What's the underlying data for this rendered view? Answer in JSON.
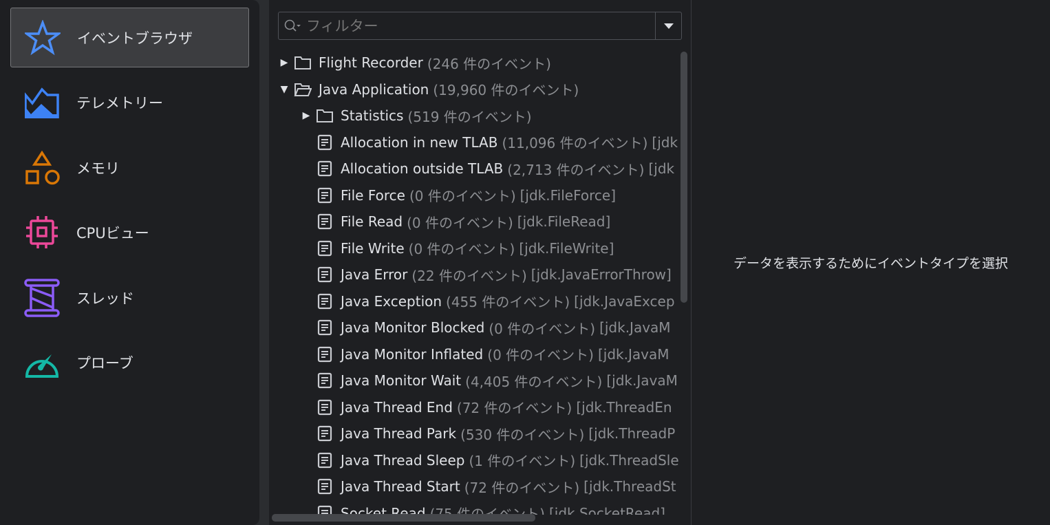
{
  "sidebar": {
    "items": [
      {
        "label": "イベントブラウザ",
        "icon": "star-icon",
        "color": "#4c8ef7",
        "selected": true
      },
      {
        "label": "テレメトリー",
        "icon": "telemetry-chart-icon",
        "color": "#3d82f5"
      },
      {
        "label": "メモリ",
        "icon": "shapes-icon",
        "color": "#d97706"
      },
      {
        "label": "CPUビュー",
        "icon": "cpu-chip-icon",
        "color": "#ec4899"
      },
      {
        "label": "スレッド",
        "icon": "spool-icon",
        "color": "#8b5cf6"
      },
      {
        "label": "プローブ",
        "icon": "gauge-icon",
        "color": "#14b8a6"
      }
    ]
  },
  "filter": {
    "placeholder": "フィルター"
  },
  "tree": [
    {
      "level": 0,
      "kind": "folder",
      "expanded": false,
      "name": "Flight Recorder",
      "count": "(246 件のイベント)",
      "type": ""
    },
    {
      "level": 0,
      "kind": "folder",
      "expanded": true,
      "name": "Java Application",
      "count": "(19,960 件のイベント)",
      "type": ""
    },
    {
      "level": 1,
      "kind": "folder",
      "expanded": false,
      "name": "Statistics",
      "count": "(519 件のイベント)",
      "type": ""
    },
    {
      "level": 1,
      "kind": "event",
      "name": "Allocation in new TLAB",
      "count": "(11,096 件のイベント)",
      "type": "[jdk"
    },
    {
      "level": 1,
      "kind": "event",
      "name": "Allocation outside TLAB",
      "count": "(2,713 件のイベント)",
      "type": "[jdk"
    },
    {
      "level": 1,
      "kind": "event",
      "name": "File Force",
      "count": "(0 件のイベント)",
      "type": "[jdk.FileForce]"
    },
    {
      "level": 1,
      "kind": "event",
      "name": "File Read",
      "count": "(0 件のイベント)",
      "type": "[jdk.FileRead]"
    },
    {
      "level": 1,
      "kind": "event",
      "name": "File Write",
      "count": "(0 件のイベント)",
      "type": "[jdk.FileWrite]"
    },
    {
      "level": 1,
      "kind": "event",
      "name": "Java Error",
      "count": "(22 件のイベント)",
      "type": "[jdk.JavaErrorThrow]"
    },
    {
      "level": 1,
      "kind": "event",
      "name": "Java Exception",
      "count": "(455 件のイベント)",
      "type": "[jdk.JavaExcep"
    },
    {
      "level": 1,
      "kind": "event",
      "name": "Java Monitor Blocked",
      "count": "(0 件のイベント)",
      "type": "[jdk.JavaM"
    },
    {
      "level": 1,
      "kind": "event",
      "name": "Java Monitor Inflated",
      "count": "(0 件のイベント)",
      "type": "[jdk.JavaM"
    },
    {
      "level": 1,
      "kind": "event",
      "name": "Java Monitor Wait",
      "count": "(4,405 件のイベント)",
      "type": "[jdk.JavaM"
    },
    {
      "level": 1,
      "kind": "event",
      "name": "Java Thread End",
      "count": "(72 件のイベント)",
      "type": "[jdk.ThreadEn"
    },
    {
      "level": 1,
      "kind": "event",
      "name": "Java Thread Park",
      "count": "(530 件のイベント)",
      "type": "[jdk.ThreadP"
    },
    {
      "level": 1,
      "kind": "event",
      "name": "Java Thread Sleep",
      "count": "(1 件のイベント)",
      "type": "[jdk.ThreadSle"
    },
    {
      "level": 1,
      "kind": "event",
      "name": "Java Thread Start",
      "count": "(72 件のイベント)",
      "type": "[jdk.ThreadSt"
    },
    {
      "level": 1,
      "kind": "event",
      "name": "Socket Read",
      "count": "(75 件のイベント)",
      "type": "[jdk.SocketRead]"
    }
  ],
  "detail": {
    "message": "データを表示するためにイベントタイプを選択"
  }
}
